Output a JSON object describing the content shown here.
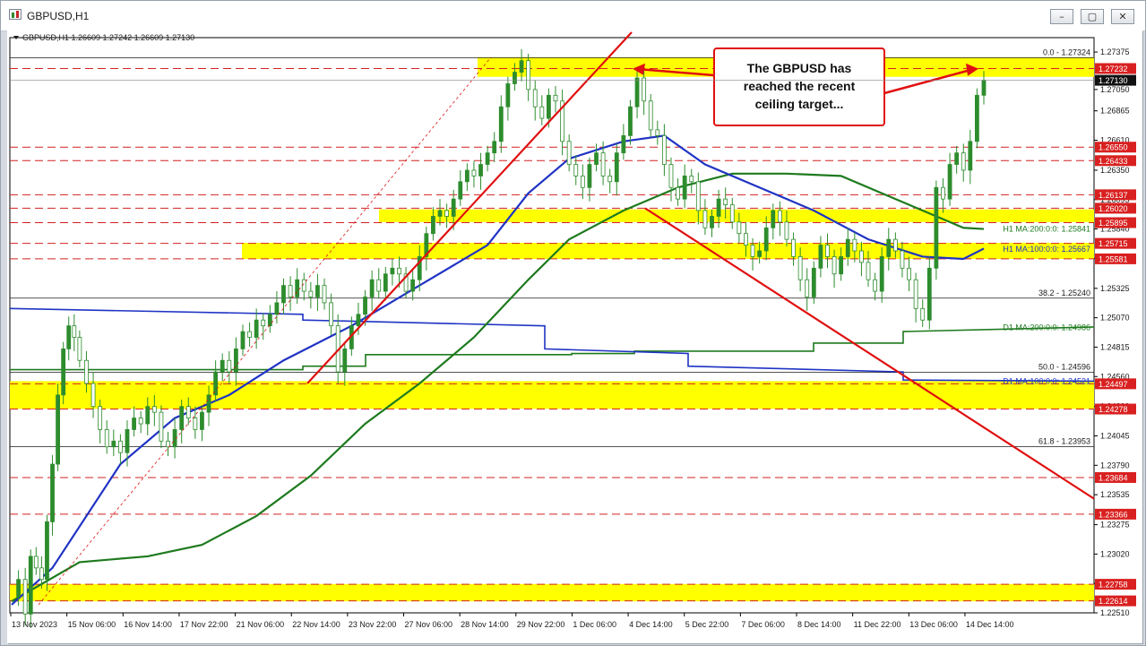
{
  "window": {
    "title": "GBPUSD,H1",
    "icon": "chart-icon",
    "buttons": {
      "minimize": "–",
      "maximize": "▢",
      "close": "✕"
    }
  },
  "colors": {
    "zone": "#ffff00",
    "level_line": "#d22020",
    "trend_line": "#e01010",
    "ma_blue": "#1f33c4",
    "ma_green": "#1e7a1e",
    "text": "#1a1a1a",
    "price_label_bg": "#d92020",
    "current_label_bg": "#111111"
  },
  "chart_data": {
    "type": "candlestick",
    "symbol": "GBPUSD",
    "timeframe": "H1",
    "ohlc_header": "GBPUSD,H1  1.26609 1.27242 1.26609 1.27130",
    "ylim": [
      1.2251,
      1.275
    ],
    "y_ticks": [
      "1.27375",
      "1.27050",
      "1.26865",
      "1.26610",
      "1.26350",
      "1.26095",
      "1.25840",
      "1.25585",
      "1.25325",
      "1.25070",
      "1.24815",
      "1.24560",
      "1.24300",
      "1.24045",
      "1.23790",
      "1.23535",
      "1.23275",
      "1.23020",
      "1.22765",
      "1.22510"
    ],
    "x_labels": [
      "13 Nov 2023",
      "15 Nov 06:00",
      "16 Nov 14:00",
      "17 Nov 22:00",
      "21 Nov 06:00",
      "22 Nov 14:00",
      "23 Nov 22:00",
      "27 Nov 06:00",
      "28 Nov 14:00",
      "29 Nov 22:00",
      "1 Dec 06:00",
      "4 Dec 14:00",
      "5 Dec 22:00",
      "7 Dec 06:00",
      "8 Dec 14:00",
      "11 Dec 22:00",
      "13 Dec 06:00",
      "14 Dec 14:00"
    ],
    "current_price": "1.27130",
    "levels": [
      "1.27232",
      "1.26550",
      "1.26433",
      "1.26137",
      "1.26020",
      "1.25895",
      "1.25715",
      "1.25581",
      "1.24497",
      "1.24278",
      "1.23684",
      "1.23366",
      "1.22758",
      "1.22614"
    ],
    "zones": [
      {
        "from": 1.2716,
        "to": 1.2733
      },
      {
        "from": 1.259,
        "to": 1.2601
      },
      {
        "from": 1.2558,
        "to": 1.2572
      },
      {
        "from": 1.2428,
        "to": 1.2452
      },
      {
        "from": 1.2261,
        "to": 1.2276
      }
    ],
    "fibonacci": [
      {
        "label": "0.0 - 1.27324",
        "value": 1.27324
      },
      {
        "label": "38.2 - 1.25240",
        "value": 1.2524
      },
      {
        "label": "50.0 - 1.24596",
        "value": 1.24596
      },
      {
        "label": "61.8 - 1.23953",
        "value": 1.23953
      }
    ],
    "ma_labels": [
      {
        "label": "H1 MA:200:0:0: 1.25841",
        "value": 1.25841,
        "color_key": "ma_green"
      },
      {
        "label": "H1 MA:100:0:0: 1.25667",
        "value": 1.25667,
        "color_key": "ma_blue"
      },
      {
        "label": "D1 MA:200:0:0: 1.24986",
        "value": 1.24986,
        "color_key": "ma_green"
      },
      {
        "label": "D1 MA:100:0:0: 1.24521",
        "value": 1.24521,
        "color_key": "ma_blue"
      }
    ],
    "annotation": {
      "lines": [
        "The GBPUSD has",
        "reached the recent",
        "ceiling target..."
      ]
    },
    "price_path": [
      [
        0,
        1.2265
      ],
      [
        0.05,
        1.228
      ],
      [
        0.1,
        1.225
      ],
      [
        0.14,
        1.23
      ],
      [
        0.18,
        1.229
      ],
      [
        0.22,
        1.228
      ],
      [
        0.26,
        1.233
      ],
      [
        0.3,
        1.238
      ],
      [
        0.34,
        1.244
      ],
      [
        0.38,
        1.248
      ],
      [
        0.42,
        1.25
      ],
      [
        0.46,
        1.249
      ],
      [
        0.5,
        1.247
      ],
      [
        0.55,
        1.245
      ],
      [
        0.6,
        1.243
      ],
      [
        0.65,
        1.241
      ],
      [
        0.7,
        1.2395
      ],
      [
        0.75,
        1.24
      ],
      [
        0.8,
        1.239
      ],
      [
        0.85,
        1.241
      ],
      [
        0.9,
        1.242
      ],
      [
        0.95,
        1.2415
      ],
      [
        1.0,
        1.243
      ],
      [
        1.05,
        1.2425
      ],
      [
        1.1,
        1.24
      ],
      [
        1.15,
        1.2395
      ],
      [
        1.2,
        1.241
      ],
      [
        1.25,
        1.243
      ],
      [
        1.3,
        1.242
      ],
      [
        1.35,
        1.241
      ],
      [
        1.4,
        1.2425
      ],
      [
        1.45,
        1.244
      ],
      [
        1.5,
        1.246
      ],
      [
        1.55,
        1.247
      ],
      [
        1.6,
        1.246
      ],
      [
        1.65,
        1.248
      ],
      [
        1.7,
        1.2495
      ],
      [
        1.75,
        1.249
      ],
      [
        1.8,
        1.2505
      ],
      [
        1.85,
        1.25
      ],
      [
        1.9,
        1.251
      ],
      [
        1.95,
        1.252
      ],
      [
        2.0,
        1.2535
      ],
      [
        2.05,
        1.2525
      ],
      [
        2.1,
        1.254
      ],
      [
        2.15,
        1.253
      ],
      [
        2.2,
        1.2525
      ],
      [
        2.25,
        1.2535
      ],
      [
        2.3,
        1.252
      ],
      [
        2.35,
        1.25
      ],
      [
        2.4,
        1.246
      ],
      [
        2.45,
        1.248
      ],
      [
        2.5,
        1.25
      ],
      [
        2.55,
        1.251
      ],
      [
        2.6,
        1.2525
      ],
      [
        2.65,
        1.254
      ],
      [
        2.7,
        1.253
      ],
      [
        2.75,
        1.2545
      ],
      [
        2.8,
        1.255
      ],
      [
        2.85,
        1.2545
      ],
      [
        2.9,
        1.253
      ],
      [
        2.95,
        1.254
      ],
      [
        3.0,
        1.256
      ],
      [
        3.05,
        1.258
      ],
      [
        3.1,
        1.2595
      ],
      [
        3.15,
        1.26
      ],
      [
        3.2,
        1.2595
      ],
      [
        3.25,
        1.261
      ],
      [
        3.3,
        1.2625
      ],
      [
        3.35,
        1.2635
      ],
      [
        3.4,
        1.263
      ],
      [
        3.45,
        1.264
      ],
      [
        3.5,
        1.265
      ],
      [
        3.55,
        1.266
      ],
      [
        3.6,
        1.269
      ],
      [
        3.65,
        1.271
      ],
      [
        3.7,
        1.272
      ],
      [
        3.75,
        1.273
      ],
      [
        3.8,
        1.2705
      ],
      [
        3.85,
        1.269
      ],
      [
        3.9,
        1.268
      ],
      [
        3.95,
        1.27
      ],
      [
        4.0,
        1.2695
      ],
      [
        4.05,
        1.266
      ],
      [
        4.1,
        1.264
      ],
      [
        4.15,
        1.263
      ],
      [
        4.2,
        1.262
      ],
      [
        4.25,
        1.264
      ],
      [
        4.3,
        1.265
      ],
      [
        4.35,
        1.263
      ],
      [
        4.4,
        1.2625
      ],
      [
        4.45,
        1.265
      ],
      [
        4.5,
        1.2665
      ],
      [
        4.55,
        1.269
      ],
      [
        4.6,
        1.2715
      ],
      [
        4.65,
        1.2695
      ],
      [
        4.7,
        1.267
      ],
      [
        4.75,
        1.2665
      ],
      [
        4.8,
        1.264
      ],
      [
        4.85,
        1.262
      ],
      [
        4.9,
        1.261
      ],
      [
        4.95,
        1.263
      ],
      [
        5.0,
        1.2625
      ],
      [
        5.05,
        1.26
      ],
      [
        5.1,
        1.2585
      ],
      [
        5.15,
        1.2595
      ],
      [
        5.2,
        1.261
      ],
      [
        5.25,
        1.2605
      ],
      [
        5.3,
        1.259
      ],
      [
        5.35,
        1.258
      ],
      [
        5.4,
        1.257
      ],
      [
        5.45,
        1.256
      ],
      [
        5.5,
        1.2565
      ],
      [
        5.55,
        1.2585
      ],
      [
        5.6,
        1.26
      ],
      [
        5.65,
        1.259
      ],
      [
        5.7,
        1.2575
      ],
      [
        5.75,
        1.256
      ],
      [
        5.8,
        1.254
      ],
      [
        5.85,
        1.2525
      ],
      [
        5.9,
        1.255
      ],
      [
        5.95,
        1.257
      ],
      [
        6.0,
        1.256
      ],
      [
        6.05,
        1.2545
      ],
      [
        6.1,
        1.256
      ],
      [
        6.15,
        1.2575
      ],
      [
        6.2,
        1.2565
      ],
      [
        6.25,
        1.2555
      ],
      [
        6.3,
        1.254
      ],
      [
        6.35,
        1.253
      ],
      [
        6.4,
        1.256
      ],
      [
        6.45,
        1.2575
      ],
      [
        6.5,
        1.2565
      ],
      [
        6.55,
        1.255
      ],
      [
        6.6,
        1.254
      ],
      [
        6.65,
        1.2515
      ],
      [
        6.7,
        1.2505
      ],
      [
        6.75,
        1.255
      ],
      [
        6.8,
        1.262
      ],
      [
        6.85,
        1.261
      ],
      [
        6.9,
        1.264
      ],
      [
        6.95,
        1.265
      ],
      [
        7.0,
        1.2635
      ],
      [
        7.05,
        1.266
      ],
      [
        7.1,
        1.27
      ],
      [
        7.15,
        1.2713
      ]
    ],
    "ma_blue_path": [
      [
        0,
        1.2258
      ],
      [
        0.3,
        1.229
      ],
      [
        0.8,
        1.238
      ],
      [
        1.2,
        1.242
      ],
      [
        1.6,
        1.244
      ],
      [
        2.0,
        1.247
      ],
      [
        2.5,
        1.25
      ],
      [
        3.0,
        1.2535
      ],
      [
        3.5,
        1.257
      ],
      [
        3.8,
        1.2615
      ],
      [
        4.1,
        1.2645
      ],
      [
        4.5,
        1.266
      ],
      [
        4.8,
        1.2665
      ],
      [
        5.1,
        1.264
      ],
      [
        5.5,
        1.262
      ],
      [
        5.9,
        1.26
      ],
      [
        6.3,
        1.2575
      ],
      [
        6.7,
        1.256
      ],
      [
        7.0,
        1.2558
      ],
      [
        7.15,
        1.2567
      ]
    ],
    "ma_green_path": [
      [
        0,
        1.2261
      ],
      [
        0.5,
        1.2295
      ],
      [
        1.0,
        1.23
      ],
      [
        1.4,
        1.231
      ],
      [
        1.8,
        1.2335
      ],
      [
        2.2,
        1.237
      ],
      [
        2.6,
        1.2415
      ],
      [
        3.0,
        1.245
      ],
      [
        3.4,
        1.249
      ],
      [
        3.8,
        1.254
      ],
      [
        4.1,
        1.2575
      ],
      [
        4.5,
        1.26
      ],
      [
        4.9,
        1.262
      ],
      [
        5.3,
        1.2632
      ],
      [
        5.7,
        1.2632
      ],
      [
        6.1,
        1.263
      ],
      [
        6.5,
        1.261
      ],
      [
        6.8,
        1.2595
      ],
      [
        7.0,
        1.2585
      ],
      [
        7.15,
        1.2584
      ]
    ]
  }
}
